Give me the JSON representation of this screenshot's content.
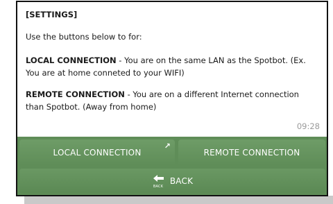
{
  "message": {
    "title": "[SETTINGS]",
    "intro": "Use the buttons below to for:",
    "local_heading": "LOCAL CONNECTION",
    "local_text": " - You are on the same LAN as the Spotbot. (Ex. You are at home conneted to your WIFI)",
    "remote_heading": "REMOTE CONNECTION",
    "remote_text": " - You are on a different Internet connection than Spotbot. (Away from home)",
    "time": "09:28"
  },
  "keyboard": {
    "local_label": "LOCAL CONNECTION",
    "local_arrow": "↗",
    "remote_label": "REMOTE CONNECTION",
    "back_label": "BACK",
    "back_icon_text": "BACK"
  },
  "colors": {
    "keyboard_bg": "#5f8d58",
    "button_text": "#ffffff",
    "timestamp": "#9a9a9a"
  }
}
